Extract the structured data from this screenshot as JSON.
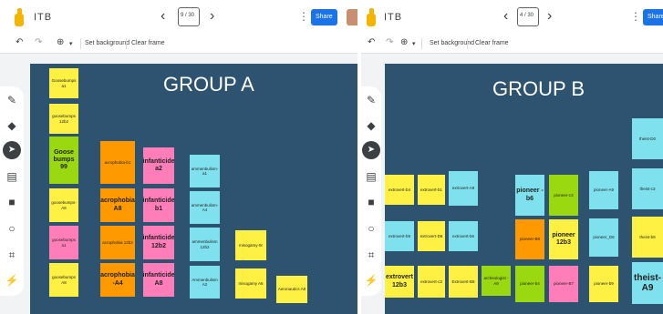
{
  "app": {
    "title": "ITB",
    "frame_label": "9 / 30",
    "frame_label_b": "4 / 30",
    "share_label": "Share"
  },
  "toolbar": {
    "set_background": "Set background",
    "clear_frame": "Clear frame"
  },
  "groupA": {
    "title": "GROUP A",
    "notes": [
      "Goosebumps a1",
      "goosebumps 12b2",
      "Goose bumps 99",
      "goosebumps-A6",
      "goosebumps a1",
      "goosebumps A8",
      "acrophobia-b1",
      "acrophobia A8",
      "acrophobia 12b2",
      "acrophobia -A4",
      "infanticide a2",
      "infanticide b1",
      "infanticide 12b2",
      "infanticide A8",
      "ammenbulism-a1",
      "ammenbulism-A4",
      "ammenbulism 12b2",
      "Ammenbulism A2",
      "misogamy-9r",
      "misogamy A6",
      "Aeronautics A8"
    ]
  },
  "groupB": {
    "title": "GROUP B",
    "notes": [
      "extrovert-b4",
      "extrovert-b1",
      "extrovert-A9",
      "extrovert-b9",
      "extrovert-D6",
      "extrovert-b6",
      "extrovert 12b3",
      "extrovert-c3",
      "Extrovert-B8",
      "archeologist -A9",
      "pioneer -b6",
      "pioneer-c3",
      "pioneer-B8",
      "pioneer 12b3",
      "pioneer-b4",
      "pioneer-B7",
      "pioneer-A9",
      "pioneer_D6",
      "pioneer-b9",
      "theist-D0",
      "theist-c3",
      "theist-b9",
      "theist- A9"
    ]
  }
}
